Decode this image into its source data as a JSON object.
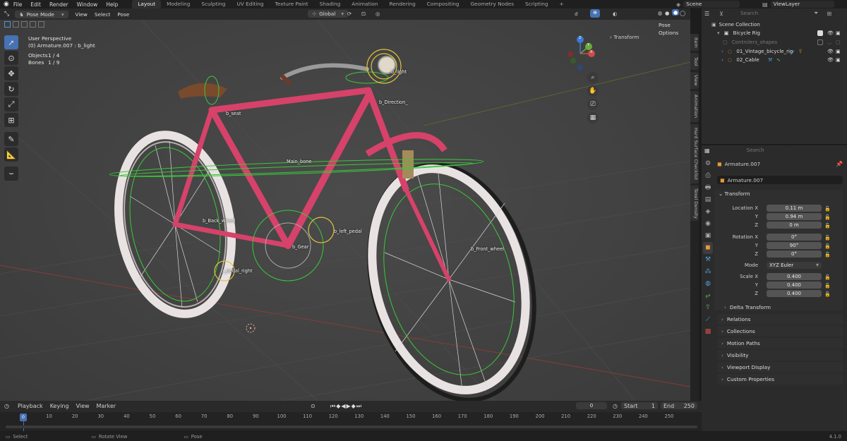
{
  "app": {
    "menus": [
      "File",
      "Edit",
      "Render",
      "Window",
      "Help"
    ],
    "workspaces": [
      "Layout",
      "Modeling",
      "Sculpting",
      "UV Editing",
      "Texture Paint",
      "Shading",
      "Animation",
      "Rendering",
      "Compositing",
      "Geometry Nodes",
      "Scripting"
    ],
    "active_workspace": "Layout",
    "add_tab": "+",
    "scene": "Scene",
    "view_layer": "ViewLayer"
  },
  "viewport_header": {
    "mode": "Pose Mode",
    "menus": [
      "View",
      "Select",
      "Pose"
    ],
    "orientation": "Global",
    "pose_options": "Pose Options",
    "transform_tab": "Transform"
  },
  "overlay": {
    "view_name": "User Perspective",
    "active": "(0) Armature.007 : b_light",
    "objects_label": "Objects",
    "objects_value": "1 / 4",
    "bones_label": "Bones",
    "bones_value": "1 / 9"
  },
  "bones": {
    "light": "b_light",
    "seat": "b_seat",
    "direction": "b_Direction_",
    "main": "Main_bone",
    "back_wheel": "b_Back_wheel",
    "left_pedal": "b_left_pedal",
    "gear": "b_Gear",
    "front_wheel": "b_Front_wheel",
    "pedal_right": "b_pedal_right"
  },
  "gizmo": {
    "x": "X",
    "y": "Y",
    "z": "Z"
  },
  "side_tabs": [
    "Item",
    "Tool",
    "View",
    "Animation",
    "Hard Surface Checklist",
    "Texel Density"
  ],
  "outliner": {
    "search_placeholder": "Search",
    "root": "Scene Collection",
    "collection": "Bicycle Rig",
    "items": [
      "Controlers_shapes",
      "01_Vintage_bicycle_rig",
      "02_Cable"
    ]
  },
  "properties": {
    "search_placeholder": "Search",
    "object_name": "Armature.007",
    "data_name": "Armature.007",
    "transform_title": "Transform",
    "location_label": "Location X",
    "rotation_label": "Rotation X",
    "scale_label": "Scale X",
    "y_label": "Y",
    "z_label": "Z",
    "location": [
      "0.11 m",
      "0.94 m",
      "0 m"
    ],
    "rotation": [
      "0°",
      "90°",
      "0°"
    ],
    "mode_label": "Mode",
    "mode_value": "XYZ Euler",
    "scale": [
      "0.400",
      "0.400",
      "0.400"
    ],
    "delta": "Delta Transform",
    "panels": [
      "Relations",
      "Collections",
      "Motion Paths",
      "Visibility",
      "Viewport Display",
      "Custom Properties"
    ]
  },
  "timeline": {
    "menus": [
      "Playback",
      "Keying",
      "View",
      "Marker"
    ],
    "current_frame": "0",
    "start_label": "Start",
    "start_value": "1",
    "end_label": "End",
    "end_value": "250",
    "ruler": [
      "0",
      "10",
      "20",
      "30",
      "40",
      "50",
      "60",
      "70",
      "80",
      "90",
      "100",
      "110",
      "120",
      "130",
      "140",
      "150",
      "160",
      "170",
      "180",
      "190",
      "200",
      "210",
      "220",
      "230",
      "240",
      "250"
    ],
    "playhead": "0"
  },
  "status": {
    "select": "Select",
    "rotate": "Rotate View",
    "pose": "Pose",
    "version": "4.1.0"
  },
  "colors": {
    "accent": "#4772b3",
    "frame": "#d6426a",
    "bone": "#39c93a",
    "bone_active": "#e0c43a"
  }
}
